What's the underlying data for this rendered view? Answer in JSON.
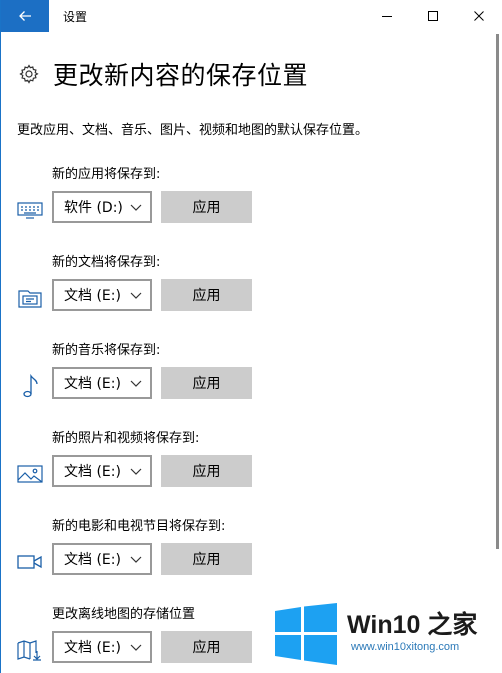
{
  "window": {
    "title": "设置",
    "controls": {
      "back": "back-arrow-icon",
      "minimize": "minimize-icon",
      "maximize": "maximize-icon",
      "close": "close-icon"
    }
  },
  "header": {
    "icon": "gear-icon",
    "title": "更改新内容的保存位置"
  },
  "description": "更改应用、文档、音乐、图片、视频和地图的默认保存位置。",
  "sections": [
    {
      "label": "新的应用将保存到:",
      "icon": "monitor-keyboard-icon",
      "selected": "软件 (D:)",
      "button": "应用"
    },
    {
      "label": "新的文档将保存到:",
      "icon": "document-drive-icon",
      "selected": "文档 (E:)",
      "button": "应用"
    },
    {
      "label": "新的音乐将保存到:",
      "icon": "music-note-icon",
      "selected": "文档 (E:)",
      "button": "应用"
    },
    {
      "label": "新的照片和视频将保存到:",
      "icon": "picture-icon",
      "selected": "文档 (E:)",
      "button": "应用"
    },
    {
      "label": "新的电影和电视节目将保存到:",
      "icon": "video-camera-icon",
      "selected": "文档 (E:)",
      "button": "应用"
    },
    {
      "label": "更改离线地图的存储位置",
      "icon": "map-download-icon",
      "selected": "文档 (E:)",
      "button": "应用"
    }
  ],
  "watermark": {
    "logo": "windows-logo",
    "name": "Win10 之家",
    "url": "www.win10xitong.com"
  },
  "colors": {
    "accent": "#1c6fc4",
    "button_bg": "#cccccc",
    "select_border": "#999999",
    "icon_blue": "#1a5fa8",
    "logo_blue": "#1da1f2"
  }
}
